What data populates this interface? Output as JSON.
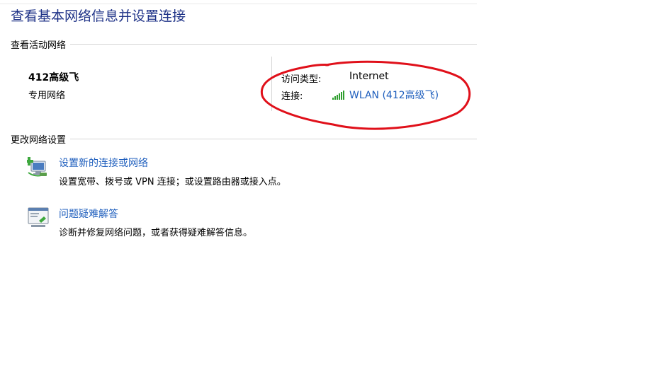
{
  "page_title": "查看基本网络信息并设置连接",
  "active_networks": {
    "header": "查看活动网络",
    "network": {
      "name": "412高级飞",
      "type": "专用网络"
    },
    "access_type_label": "访问类型:",
    "access_type_value": "Internet",
    "connection_label": "连接:",
    "connection_value": "WLAN (412高级飞)",
    "connection_icon": "wifi-signal-icon"
  },
  "change_settings": {
    "header": "更改网络设置",
    "tasks": [
      {
        "icon": "new-connection-icon",
        "link": "设置新的连接或网络",
        "description": "设置宽带、拨号或 VPN 连接；或设置路由器或接入点。"
      },
      {
        "icon": "troubleshoot-icon",
        "link": "问题疑难解答",
        "description": "诊断并修复网络问题，或者获得疑难解答信息。"
      }
    ]
  },
  "colors": {
    "title": "#1e3287",
    "link": "#1e5ebd",
    "annotation": "#e0101a",
    "signal": "#2f9e2f"
  }
}
